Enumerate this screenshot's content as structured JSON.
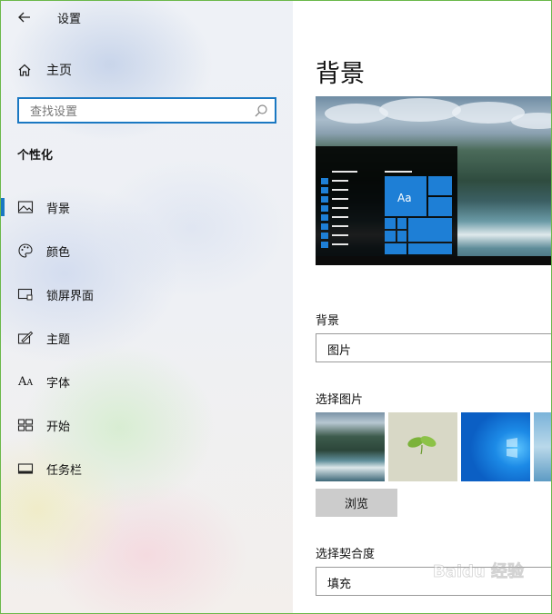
{
  "window": {
    "title": "设置"
  },
  "sidebar": {
    "home_label": "主页",
    "search": {
      "placeholder": "查找设置",
      "value": ""
    },
    "section_heading": "个性化",
    "items": [
      {
        "label": "背景",
        "icon": "picture-icon",
        "active": true
      },
      {
        "label": "颜色",
        "icon": "palette-icon",
        "active": false
      },
      {
        "label": "锁屏界面",
        "icon": "lock-screen-icon",
        "active": false
      },
      {
        "label": "主题",
        "icon": "theme-brush-icon",
        "active": false
      },
      {
        "label": "字体",
        "icon": "font-icon",
        "active": false
      },
      {
        "label": "开始",
        "icon": "start-tiles-icon",
        "active": false
      },
      {
        "label": "任务栏",
        "icon": "taskbar-icon",
        "active": false
      }
    ]
  },
  "main": {
    "title": "背景",
    "preview": {
      "tile_text": "Aa"
    },
    "background_label": "背景",
    "background_value": "图片",
    "choose_picture_label": "选择图片",
    "browse_label": "浏览",
    "fit_label": "选择契合度",
    "fit_value": "填充"
  },
  "watermark": {
    "text": "Baidu 经验"
  },
  "colors": {
    "accent": "#1a78c2",
    "tile": "#1e7fd6",
    "button": "#cccccc"
  }
}
